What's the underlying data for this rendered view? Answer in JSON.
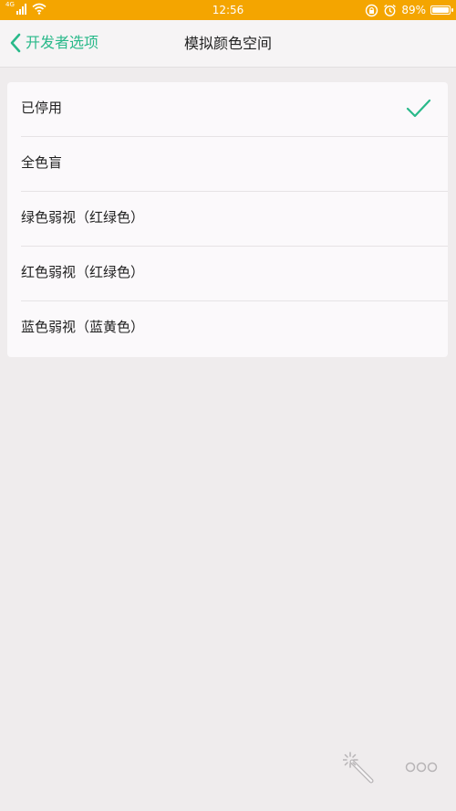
{
  "status_bar": {
    "network": "4G",
    "time": "12:56",
    "battery_text": "89%",
    "battery_level": 0.89,
    "icons": [
      "signal-icon",
      "wifi-icon",
      "rotation-lock-icon",
      "alarm-icon",
      "battery-icon"
    ]
  },
  "nav": {
    "back_label": "开发者选项",
    "title": "模拟颜色空间"
  },
  "options": [
    {
      "label": "已停用",
      "selected": true
    },
    {
      "label": "全色盲",
      "selected": false
    },
    {
      "label": "绿色弱视（红绿色）",
      "selected": false
    },
    {
      "label": "红色弱视（红绿色）",
      "selected": false
    },
    {
      "label": "蓝色弱视（蓝黄色）",
      "selected": false
    }
  ],
  "colors": {
    "status_bar": "#f4a500",
    "accent": "#29b98a",
    "background": "#efeced",
    "card": "#fbf9fb"
  },
  "bottom": {
    "icons": [
      "magic-wand-icon",
      "more-icon"
    ]
  }
}
